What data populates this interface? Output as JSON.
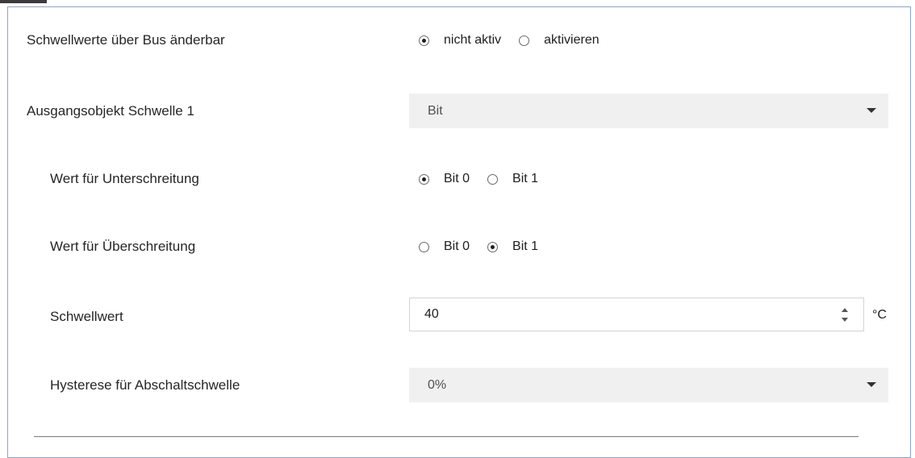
{
  "settings": {
    "bus_threshold": {
      "label": "Schwellwerte über Bus änderbar",
      "options": [
        "nicht aktiv",
        "aktivieren"
      ],
      "selected": "nicht aktiv"
    },
    "output_object": {
      "label": "Ausgangsobjekt Schwelle 1",
      "value": "Bit"
    },
    "under_value": {
      "label": "Wert für Unterschreitung",
      "options": [
        "Bit 0",
        "Bit 1"
      ],
      "selected": "Bit 0"
    },
    "over_value": {
      "label": "Wert für Überschreitung",
      "options": [
        "Bit 0",
        "Bit 1"
      ],
      "selected": "Bit 1"
    },
    "threshold": {
      "label": "Schwellwert",
      "value": "40",
      "unit": "°C"
    },
    "hysteresis": {
      "label": "Hysterese für Abschaltschwelle",
      "value": "0%"
    }
  }
}
